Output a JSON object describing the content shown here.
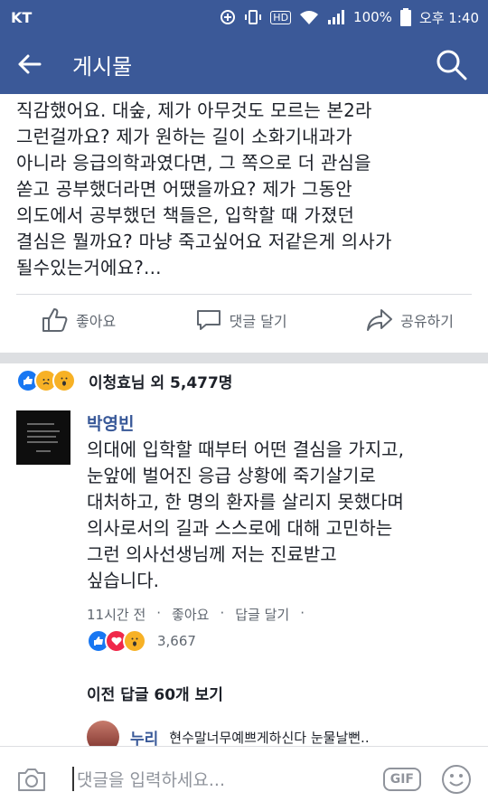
{
  "statusbar": {
    "carrier": "KT",
    "hd": "HD",
    "battery": "100%",
    "time": "오후 1:40"
  },
  "appbar": {
    "title": "게시물"
  },
  "post": {
    "lines": [
      "직감했어요. 대숲, 제가 아무것도 모르는 본2라",
      "그런걸까요? 제가 원하는 길이 소화기내과가",
      "아니라 응급의학과였다면, 그 쪽으로 더 관심을",
      "쏟고 공부했더라면 어땠을까요? 제가 그동안",
      "의도에서 공부했던 책들은, 입학할 때 가졌던",
      "결심은 뭘까요? 마냥 죽고싶어요 저같은게 의사가",
      "될수있는거에요?..."
    ],
    "like_label": "좋아요",
    "comment_label": "댓글 달기",
    "share_label": "공유하기"
  },
  "reactions": {
    "summary": "이청효님 외 5,477명"
  },
  "comment": {
    "name": "박영빈",
    "lines": [
      "의대에 입학할 때부터 어떤 결심을 가지고,",
      "눈앞에 벌어진 응급 상황에 죽기살기로",
      "대처하고, 한 명의 환자를 살리지 못했다며",
      "의사로서의 길과 스스로에 대해 고민하는",
      "그런 의사선생님께 저는 진료받고",
      "싶습니다."
    ],
    "time": "11시간 전",
    "like": "좋아요",
    "reply": "답글 달기",
    "reaction_count": "3,667"
  },
  "prev_replies": "이전 답글 60개 보기",
  "reply": {
    "name": "누리",
    "text": "현수말너무예쁘게하신다 눈물날뻔.."
  },
  "input": {
    "placeholder": "댓글을 입력하세요...",
    "gif": "GIF"
  },
  "colors": {
    "brand": "#3b5998",
    "link": "#385898",
    "like": "#1877f2",
    "love": "#f0284a",
    "wow": "#f7b125"
  }
}
